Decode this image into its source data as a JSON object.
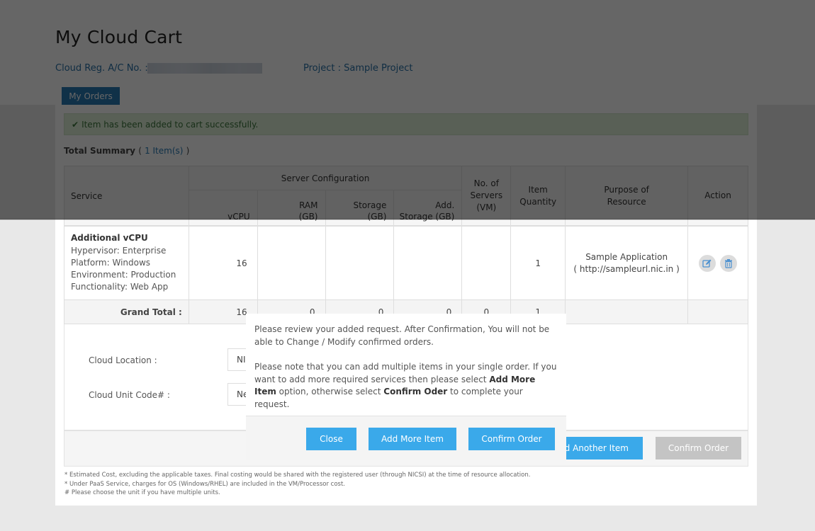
{
  "page": {
    "title": "My Cloud Cart",
    "account_label": "Cloud Reg. A/C No. :",
    "project_label": "Project : Sample Project",
    "tab_my_orders": "My Orders"
  },
  "alert": {
    "icon": "check-icon",
    "message": "Item has been added to cart successfully."
  },
  "summary": {
    "label": "Total Summary",
    "open": "(",
    "count_text": "1 Item(s)",
    "close": ")"
  },
  "table": {
    "headers": {
      "service": "Service",
      "server_configuration": "Server Configuration",
      "vcpu": "vCPU",
      "ram_line1": "RAM",
      "ram_line2": "(GB)",
      "storage_line1": "Storage",
      "storage_line2": "(GB)",
      "add_storage_line1": "Add.",
      "add_storage_line2": "Storage (GB)",
      "servers_line1": "No. of",
      "servers_line2": "Servers",
      "servers_line3": "(VM)",
      "qty_line1": "Item",
      "qty_line2": "Quantity",
      "purpose_line1": "Purpose of",
      "purpose_line2": "Resource",
      "action": "Action"
    },
    "rows": [
      {
        "service_name": "Additional vCPU",
        "details": [
          "Hypervisor: Enterprise",
          "Platform: Windows",
          "Environment: Production",
          "Functionality: Web App"
        ],
        "vcpu": "16",
        "ram": "",
        "storage": "",
        "add_storage": "",
        "servers": "",
        "quantity": "1",
        "purpose_line1": "Sample Application",
        "purpose_line2": "( http://sampleurl.nic.in )",
        "actions": [
          "edit-icon",
          "delete-icon"
        ]
      }
    ],
    "grand_total": {
      "label": "Grand Total :",
      "vcpu": "16",
      "ram": "0",
      "storage": "0",
      "add_storage": "0",
      "servers": "0",
      "quantity": "1"
    }
  },
  "form": {
    "cloud_location_label": "Cloud Location :",
    "cloud_location_value": "NI",
    "cloud_unit_label": "Cloud Unit Code# :",
    "cloud_unit_value": "Ne"
  },
  "footer_buttons": {
    "add_another": "dd Another Item",
    "confirm_order": "Confirm Order"
  },
  "notes": [
    "* Estimated Cost, excluding the applicable taxes. Final costing would be shared with the registered user (through NICSI) at the time of resource allocation.",
    "* Under PaaS Service, charges for OS (Windows/RHEL) are included in the VM/Processor cost.",
    "# Please choose the unit if you have multiple units."
  ],
  "modal": {
    "para1": "Please review your added request. After Confirmation, You will not be able to Change / Modify confirmed orders.",
    "para2_part1": "Please note that you can add multiple items in your single order. If you want to add more required services then please select ",
    "para2_bold1": "Add More Item",
    "para2_part2": " option, otherwise select ",
    "para2_bold2": "Confirm Oder",
    "para2_part3": " to complete your request.",
    "buttons": {
      "close": "Close",
      "add_more": "Add More Item",
      "confirm": "Confirm Order"
    }
  },
  "colors": {
    "primary_button": "#3aa9ea",
    "disabled_button": "#c4c4c4",
    "link_blue": "#2a72a8",
    "tab_blue": "#2a7ab5",
    "success_bg": "#dff0d8"
  }
}
